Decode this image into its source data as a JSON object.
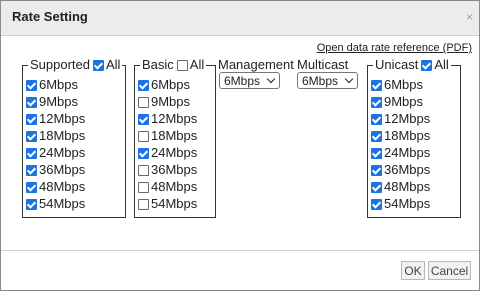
{
  "dialog": {
    "title": "Rate Setting",
    "close_glyph": "×",
    "reference_link": "Open data rate reference (PDF)"
  },
  "supported": {
    "label": "Supported",
    "all_label": "All",
    "all_checked": true,
    "rates": [
      {
        "label": "6Mbps",
        "checked": true
      },
      {
        "label": "9Mbps",
        "checked": true
      },
      {
        "label": "12Mbps",
        "checked": true
      },
      {
        "label": "18Mbps",
        "checked": true
      },
      {
        "label": "24Mbps",
        "checked": true
      },
      {
        "label": "36Mbps",
        "checked": true
      },
      {
        "label": "48Mbps",
        "checked": true
      },
      {
        "label": "54Mbps",
        "checked": true
      }
    ]
  },
  "basic": {
    "label": "Basic",
    "all_label": "All",
    "all_checked": false,
    "rates": [
      {
        "label": "6Mbps",
        "checked": true
      },
      {
        "label": "9Mbps",
        "checked": false
      },
      {
        "label": "12Mbps",
        "checked": true
      },
      {
        "label": "18Mbps",
        "checked": false
      },
      {
        "label": "24Mbps",
        "checked": true
      },
      {
        "label": "36Mbps",
        "checked": false
      },
      {
        "label": "48Mbps",
        "checked": false
      },
      {
        "label": "54Mbps",
        "checked": false
      }
    ]
  },
  "management": {
    "label": "Management",
    "value": "6Mbps"
  },
  "multicast": {
    "label": "Multicast",
    "value": "6Mbps"
  },
  "unicast": {
    "label": "Unicast",
    "all_label": "All",
    "all_checked": true,
    "rates": [
      {
        "label": "6Mbps",
        "checked": true
      },
      {
        "label": "9Mbps",
        "checked": true
      },
      {
        "label": "12Mbps",
        "checked": true
      },
      {
        "label": "18Mbps",
        "checked": true
      },
      {
        "label": "24Mbps",
        "checked": true
      },
      {
        "label": "36Mbps",
        "checked": true
      },
      {
        "label": "48Mbps",
        "checked": true
      },
      {
        "label": "54Mbps",
        "checked": true
      }
    ]
  },
  "buttons": {
    "ok": "OK",
    "cancel": "Cancel"
  },
  "colors": {
    "checkbox_checked": "#1b74e4",
    "titlebar": "#ececec"
  }
}
